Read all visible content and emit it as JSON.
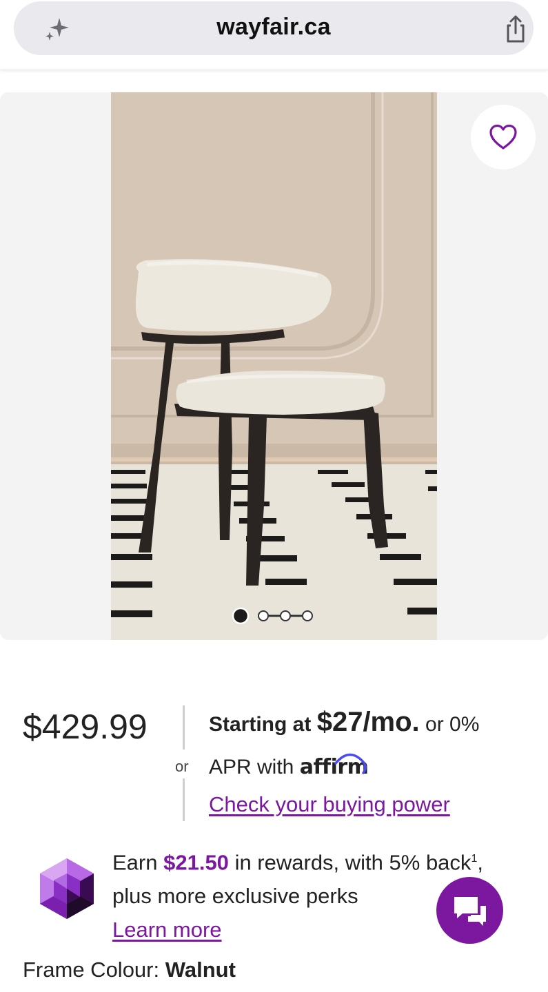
{
  "browser": {
    "domain": "wayfair.ca",
    "icons": {
      "left": "sparkle-icon",
      "right": "share-icon"
    }
  },
  "gallery": {
    "favorite_icon": "heart-icon",
    "image_count": 4,
    "active_image": 1
  },
  "pricing": {
    "price": "$429.99",
    "or": "or",
    "financing_prefix": "Starting at",
    "monthly": "$27/mo.",
    "financing_suffix": "or 0%",
    "apr_text": "APR with",
    "affirm_logo": "affirm",
    "buying_power_link": "Check your buying power"
  },
  "rewards": {
    "earn": "Earn",
    "amount": "$21.50",
    "text_after": "in rewards, with 5% back",
    "footnote": "1",
    "comma": ",",
    "line2": "plus more exclusive perks",
    "learn_more": "Learn more"
  },
  "chat": {
    "icon": "chat-bubbles-icon"
  },
  "options": {
    "frame_label": "Frame Colour:",
    "frame_value": "Walnut"
  },
  "colors": {
    "brand_purple": "#7b189f",
    "url_bar": "#e9e9ee"
  }
}
